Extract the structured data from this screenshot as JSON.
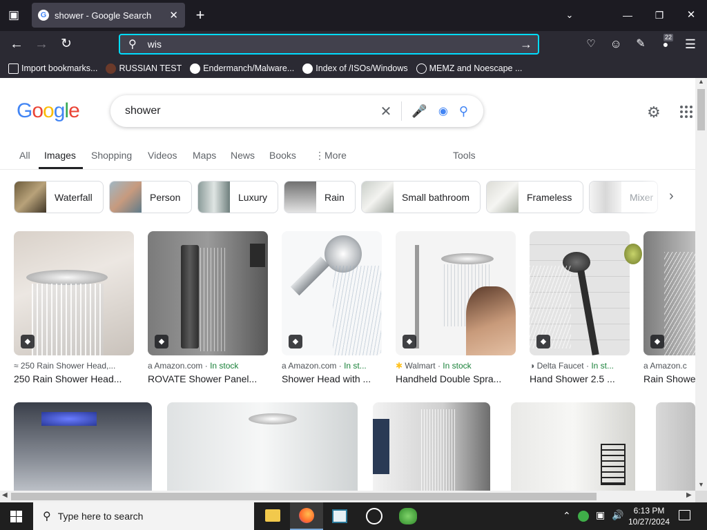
{
  "browser": {
    "tab_title": "shower - Google Search",
    "url_text": "wis",
    "extension_badge": "22",
    "bookmarks": [
      {
        "label": "Import bookmarks...",
        "icon": "import-icon"
      },
      {
        "label": "RUSSIAN TEST",
        "icon": "site-icon"
      },
      {
        "label": "Endermanch/Malware...",
        "icon": "site-icon"
      },
      {
        "label": "Index of /ISOs/Windows",
        "icon": "site-icon"
      },
      {
        "label": "MEMZ and Noescape ...",
        "icon": "globe-icon"
      }
    ]
  },
  "google": {
    "logo": "Google",
    "query": "shower",
    "nav_tabs": [
      "All",
      "Images",
      "Shopping",
      "Videos",
      "Maps",
      "News",
      "Books",
      "More"
    ],
    "tools_label": "Tools",
    "chips": [
      "Waterfall",
      "Person",
      "Luxury",
      "Rain",
      "Small bathroom",
      "Frameless",
      "Mixer"
    ],
    "results": [
      {
        "source": "250 Rain Shower Head,...",
        "stock": "",
        "title": "250 Rain Shower Head..."
      },
      {
        "source": "Amazon.com",
        "stock": "In stock",
        "title": "ROVATE Shower Panel..."
      },
      {
        "source": "Amazon.com",
        "stock": "In st...",
        "title": "Shower Head with ..."
      },
      {
        "source": "Walmart",
        "stock": "In stock",
        "title": "Handheld Double Spra..."
      },
      {
        "source": "Delta Faucet",
        "stock": "In st...",
        "title": "Hand Shower 2.5 ..."
      },
      {
        "source": "Amazon.c",
        "stock": "",
        "title": "Rain Showe"
      }
    ]
  },
  "taskbar": {
    "search_placeholder": "Type here to search",
    "time": "6:13 PM",
    "date": "10/27/2024"
  }
}
